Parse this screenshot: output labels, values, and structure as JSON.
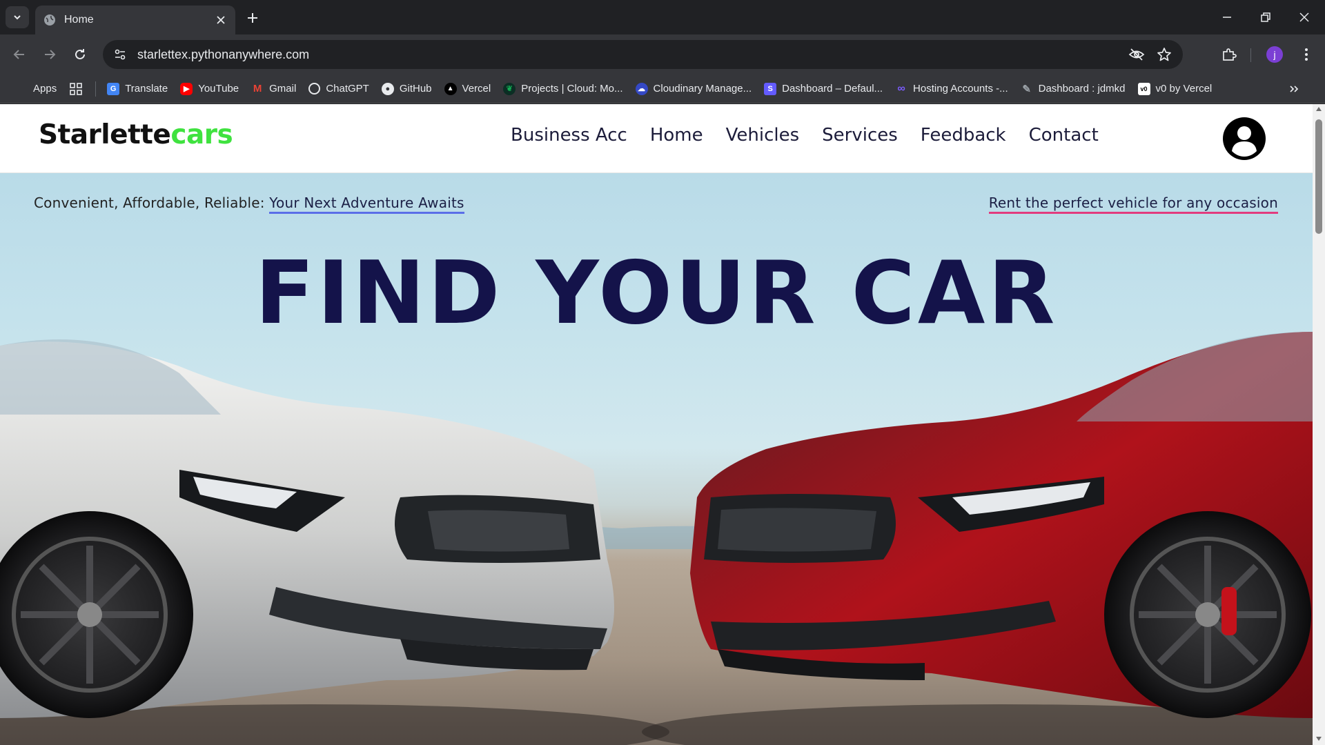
{
  "browser": {
    "tab_title": "Home",
    "url": "starlettex.pythonanywhere.com",
    "profile_initial": "j",
    "bookmarks": [
      {
        "label": "Apps",
        "icon": "apps-grid-icon",
        "color": "#ea4335"
      },
      {
        "label": "Translate",
        "icon": "translate-icon",
        "color": "#4285f4"
      },
      {
        "label": "YouTube",
        "icon": "youtube-icon",
        "color": "#ff0000"
      },
      {
        "label": "Gmail",
        "icon": "gmail-icon",
        "color": "#ea4335"
      },
      {
        "label": "ChatGPT",
        "icon": "chatgpt-icon",
        "color": "#e8eaed"
      },
      {
        "label": "GitHub",
        "icon": "github-icon",
        "color": "#e8eaed"
      },
      {
        "label": "Vercel",
        "icon": "vercel-icon",
        "color": "#000000"
      },
      {
        "label": "Projects | Cloud: Mo...",
        "icon": "mongodb-leaf-icon",
        "color": "#13aa52"
      },
      {
        "label": "Cloudinary Manage...",
        "icon": "cloudinary-icon",
        "color": "#3448c5"
      },
      {
        "label": "Dashboard – Defaul...",
        "icon": "stripe-s-icon",
        "color": "#635bff"
      },
      {
        "label": "Hosting Accounts -...",
        "icon": "infinity-icon",
        "color": "#7b5cff"
      },
      {
        "label": "Dashboard : jdmkd",
        "icon": "pen-icon",
        "color": "#9aa0a6"
      },
      {
        "label": "v0 by Vercel",
        "icon": "v0-icon",
        "color": "#ffffff"
      }
    ]
  },
  "site": {
    "logo_part1": "Starlette",
    "logo_part2": "cars",
    "logo_accent": "#3fe23f",
    "nav": [
      "Business Acc",
      "Home",
      "Vehicles",
      "Services",
      "Feedback",
      "Contact"
    ],
    "tagline_prefix": "Convenient, Affordable, Reliable: ",
    "tagline_link": "Your Next Adventure Awaits",
    "tagline_right": "Rent the perfect vehicle for any occasion",
    "hero_title": "FIND YOUR CAR",
    "title_color": "#14134a"
  }
}
